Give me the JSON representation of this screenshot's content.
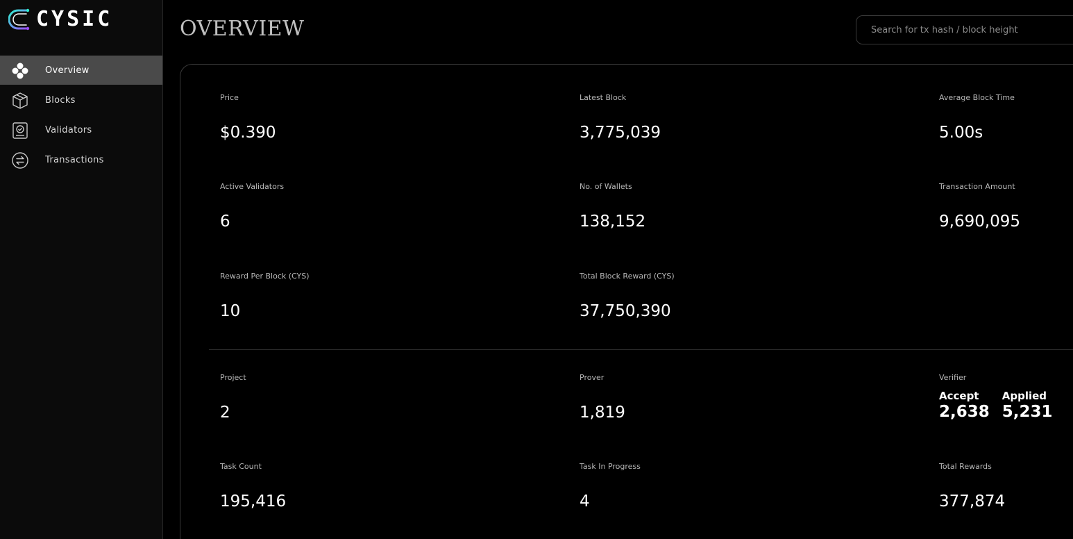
{
  "brand": {
    "name": "CYSIC"
  },
  "sidebar": {
    "items": [
      {
        "label": "Overview",
        "icon": "overview-icon",
        "active": true
      },
      {
        "label": "Blocks",
        "icon": "cube-icon",
        "active": false
      },
      {
        "label": "Validators",
        "icon": "validator-icon",
        "active": false
      },
      {
        "label": "Transactions",
        "icon": "swap-icon",
        "active": false
      }
    ]
  },
  "header": {
    "title": "OVERVIEW",
    "search_placeholder": "Search for tx hash / block height"
  },
  "stats": {
    "price": {
      "label": "Price",
      "value": "$0.390"
    },
    "latest_block": {
      "label": "Latest Block",
      "value": "3,775,039"
    },
    "avg_block_time": {
      "label": "Average Block Time",
      "value": "5.00s"
    },
    "active_validators": {
      "label": "Active Validators",
      "value": "6"
    },
    "wallets": {
      "label": "No. of Wallets",
      "value": "138,152"
    },
    "tx_amount": {
      "label": "Transaction Amount",
      "value": "9,690,095"
    },
    "reward_per_block": {
      "label": "Reward Per Block (CYS)",
      "value": "10"
    },
    "total_block_reward": {
      "label": "Total Block Reward (CYS)",
      "value": "37,750,390"
    }
  },
  "zk": {
    "project": {
      "label": "Project",
      "value": "2"
    },
    "prover": {
      "label": "Prover",
      "value": "1,819"
    },
    "verifier": {
      "label": "Verifier",
      "accept_label": "Accept",
      "accept_value": "2,638",
      "applied_label": "Applied",
      "applied_value": "5,231"
    },
    "task_count": {
      "label": "Task Count",
      "value": "195,416"
    },
    "task_in_progress": {
      "label": "Task In Progress",
      "value": "4"
    },
    "total_rewards": {
      "label": "Total Rewards",
      "value": "377,874"
    }
  },
  "colors": {
    "background": "#000000",
    "sidebar_active": "#4a4a4a",
    "logo_gradient_start": "#2ef2d0",
    "logo_gradient_end": "#9b4dff"
  }
}
